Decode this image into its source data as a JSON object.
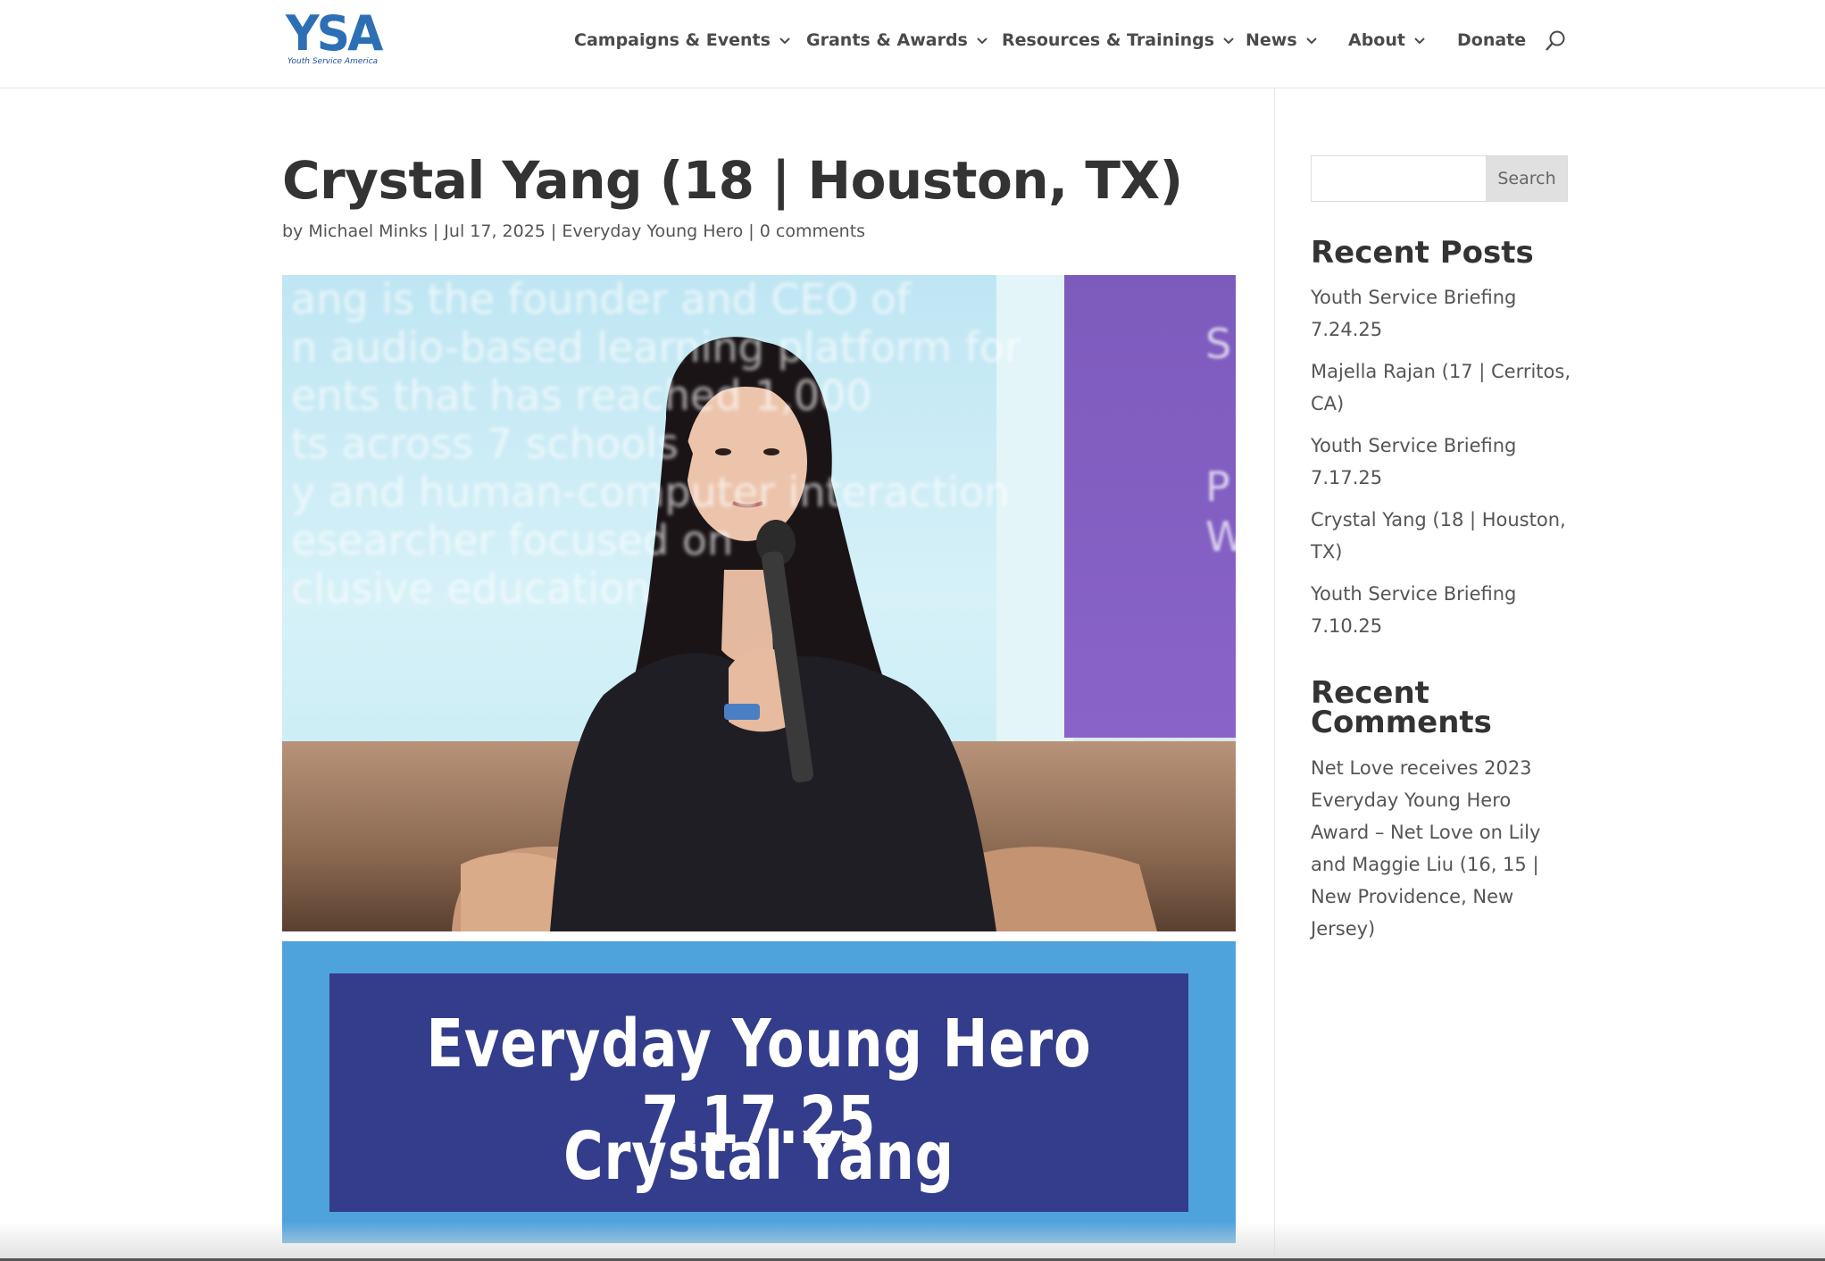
{
  "header": {
    "logo_mark": "YSA",
    "logo_tag": "Youth Service America",
    "nav": [
      {
        "label": "Campaigns & Events",
        "has_dropdown": true
      },
      {
        "label": "Grants & Awards",
        "has_dropdown": true
      },
      {
        "label": "Resources & Trainings",
        "has_dropdown": true
      },
      {
        "label": "News",
        "has_dropdown": true
      },
      {
        "label": "About",
        "has_dropdown": true
      },
      {
        "label": "Donate",
        "has_dropdown": false
      }
    ],
    "search_icon": "search-icon"
  },
  "post": {
    "title": "Crystal Yang (18 | Houston, TX)",
    "meta_by": "by",
    "author": "Michael Minks",
    "date": "Jul 17, 2025",
    "category": "Everyday Young Hero",
    "comments": "0 comments",
    "separator": "|",
    "banner_line1": "Everyday Young Hero 7.17.25",
    "banner_line2": "Crystal Yang"
  },
  "sidebar": {
    "search_placeholder": "",
    "search_button": "Search",
    "recent_posts_heading": "Recent Posts",
    "recent_posts": [
      "Youth Service Briefing 7.24.25",
      "Majella Rajan (17 | Cerritos, CA)",
      "Youth Service Briefing 7.17.25",
      "Crystal Yang (18 | Houston, TX)",
      "Youth Service Briefing 7.10.25"
    ],
    "recent_comments_heading": "Recent Comments",
    "comment": {
      "author": "Net Love receives 2023 Everyday Young Hero Award – Net Love",
      "on": "on",
      "post": "Lily and Maggie Liu (16, 15 | New Providence, New Jersey)"
    }
  },
  "colors": {
    "banner_outer": "#4fa3dd",
    "banner_inner": "#333d8c",
    "logo_blue": "#2d6fb5"
  }
}
